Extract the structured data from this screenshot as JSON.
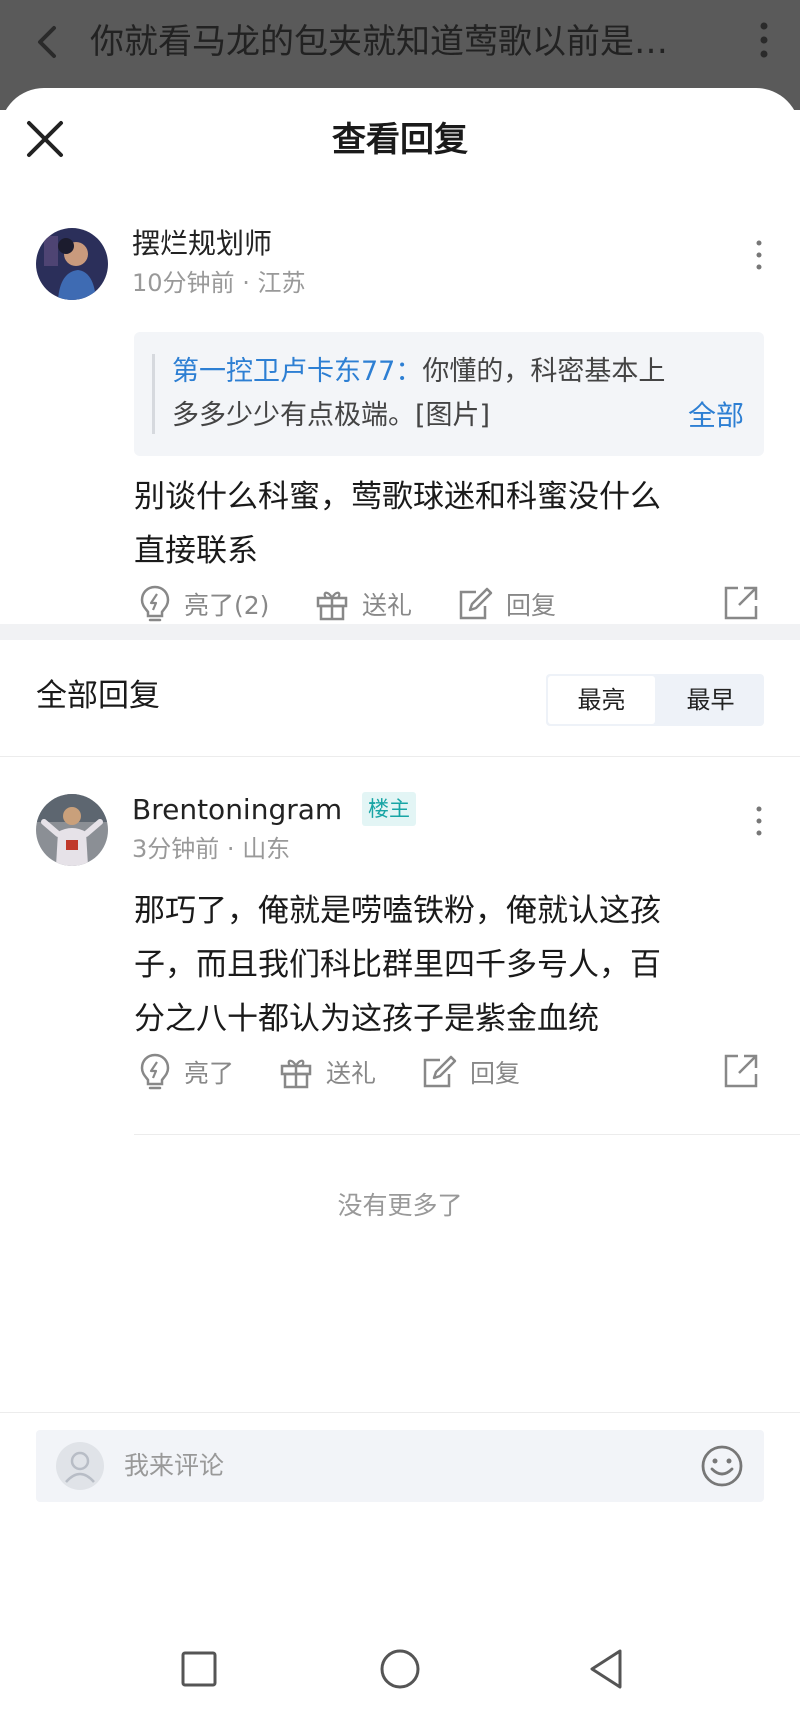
{
  "topbar": {
    "title": "你就看马龙的包夹就知道莺歌以前是…"
  },
  "sheet": {
    "title": "查看回复"
  },
  "main_comment": {
    "username": "摆烂规划师",
    "time": "10分钟前",
    "location": "江苏",
    "quote": {
      "author": "第一控卫卢卡东77：",
      "text": "你懂的，科密基本上多多少少有点极端。[图片]",
      "expand_label": "全部"
    },
    "text_line1": "别谈什么科蜜，莺歌球迷和科蜜没什么",
    "text_line2": "直接联系",
    "actions": {
      "like": "亮了(2)",
      "gift": "送礼",
      "reply": "回复"
    }
  },
  "replies_section": {
    "title": "全部回复",
    "sort_options": [
      "最亮",
      "最早"
    ],
    "active_sort": "最亮"
  },
  "reply": {
    "username": "Brentoningram",
    "badge": "楼主",
    "time": "3分钟前",
    "location": "山东",
    "text_line1": "那巧了，俺就是唠嗑铁粉，俺就认这孩",
    "text_line2": "子，而且我们科比群里四千多号人，百",
    "text_line3": "分之八十都认为这孩子是紫金血统",
    "actions": {
      "like": "亮了",
      "gift": "送礼",
      "reply": "回复"
    }
  },
  "footer": {
    "no_more": "没有更多了",
    "comment_placeholder": "我来评论"
  },
  "colors": {
    "accent_blue": "#2d7fd3",
    "badge_teal": "#18a5a5",
    "overlay": "#5a5a5a"
  }
}
